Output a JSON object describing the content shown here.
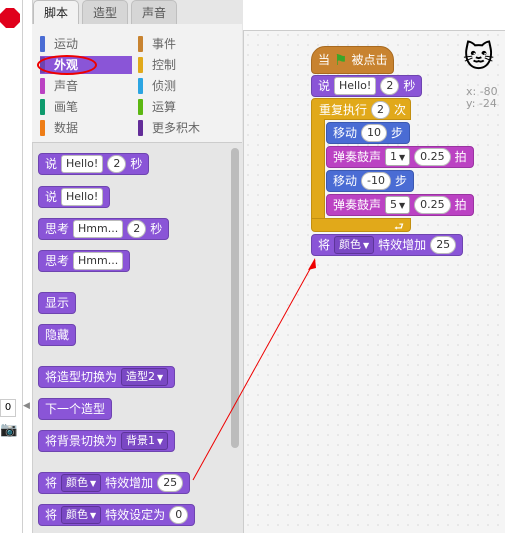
{
  "tabs": [
    "脚本",
    "造型",
    "声音"
  ],
  "categories_left": [
    "运动",
    "外观",
    "声音",
    "画笔",
    "数据"
  ],
  "categories_right": [
    "事件",
    "控制",
    "侦测",
    "运算",
    "更多积木"
  ],
  "cat_colors": {
    "motion": "#4a6cd4",
    "looks": "#8a55d7",
    "sound": "#bb42c3",
    "pen": "#0e9a6c",
    "data": "#ee7d16",
    "events": "#c88330",
    "control": "#e1a91a",
    "sensing": "#2ca5e2",
    "operators": "#5cb712",
    "more": "#632d99"
  },
  "palette": {
    "say_timed": {
      "label": "说",
      "text": "Hello!",
      "secs": "2",
      "unit": "秒"
    },
    "say": {
      "label": "说",
      "text": "Hello!"
    },
    "think_timed": {
      "label": "思考",
      "text": "Hmm...",
      "secs": "2",
      "unit": "秒"
    },
    "think": {
      "label": "思考",
      "text": "Hmm..."
    },
    "show": "显示",
    "hide": "隐藏",
    "switch_costume": {
      "label": "将造型切换为",
      "value": "造型2"
    },
    "next_costume": "下一个造型",
    "switch_backdrop": {
      "label": "将背景切换为",
      "value": "背景1"
    },
    "change_effect": {
      "label": "将",
      "effect": "颜色",
      "mid": "特效增加",
      "value": "25"
    },
    "set_effect": {
      "label": "将",
      "effect": "颜色",
      "mid": "特效设定为",
      "value": "0"
    }
  },
  "script": {
    "hat": {
      "label": "当",
      "suffix": "被点击"
    },
    "say": {
      "label": "说",
      "text": "Hello!",
      "secs": "2",
      "unit": "秒"
    },
    "repeat": {
      "label": "重复执行",
      "times": "2",
      "unit": "次"
    },
    "move1": {
      "label": "移动",
      "steps": "10",
      "unit": "步"
    },
    "play1": {
      "label": "弹奏鼓声",
      "drum": "1",
      "beats": "0.25",
      "unit": "拍"
    },
    "move2": {
      "label": "移动",
      "steps": "-10",
      "unit": "步"
    },
    "play2": {
      "label": "弹奏鼓声",
      "drum": "5",
      "beats": "0.25",
      "unit": "拍"
    },
    "effect": {
      "label": "将",
      "effect": "颜色",
      "mid": "特效增加",
      "value": "25"
    }
  },
  "stage_coords": {
    "x": "x: -80",
    "y": "y: -24"
  },
  "stage_field": "0"
}
